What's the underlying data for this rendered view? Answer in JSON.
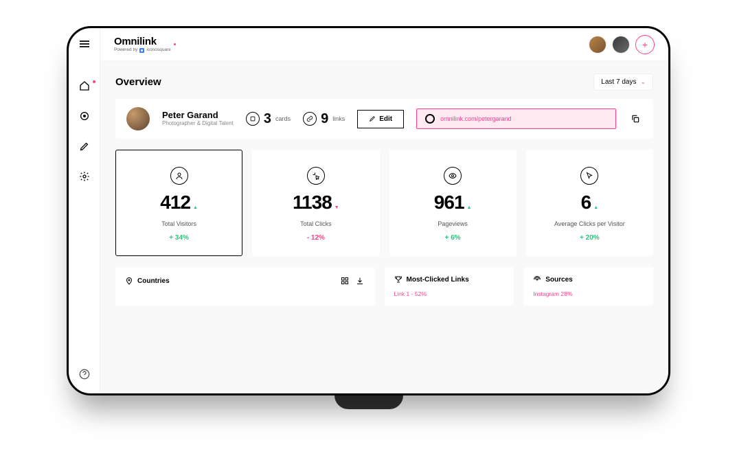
{
  "brand": {
    "name": "Omnilink",
    "powered_prefix": "Powered by",
    "powered_name": "iconosquare"
  },
  "header": {
    "add_label": "+"
  },
  "page": {
    "title": "Overview",
    "date_filter": "Last 7 days"
  },
  "profile": {
    "name": "Peter Garand",
    "role": "Photographer & Digital Talent",
    "cards": {
      "count": "3",
      "label": "cards"
    },
    "links": {
      "count": "9",
      "label": "links"
    },
    "edit": "Edit",
    "url": "omnilink.com/petergarand"
  },
  "metrics": [
    {
      "value": "412",
      "label": "Total Visitors",
      "change": "+ 34%",
      "dir": "up"
    },
    {
      "value": "1138",
      "label": "Total Clicks",
      "change": "- 12%",
      "dir": "down"
    },
    {
      "value": "961",
      "label": "Pageviews",
      "change": "+ 6%",
      "dir": "up"
    },
    {
      "value": "6",
      "label": "Average Clicks per Visitor",
      "change": "+ 20%",
      "dir": "up"
    }
  ],
  "panels": {
    "countries": {
      "title": "Countries"
    },
    "links": {
      "title": "Most-Clicked Links",
      "row": "Link 1 - 52%"
    },
    "sources": {
      "title": "Sources",
      "row": "Instagram 28%"
    }
  }
}
